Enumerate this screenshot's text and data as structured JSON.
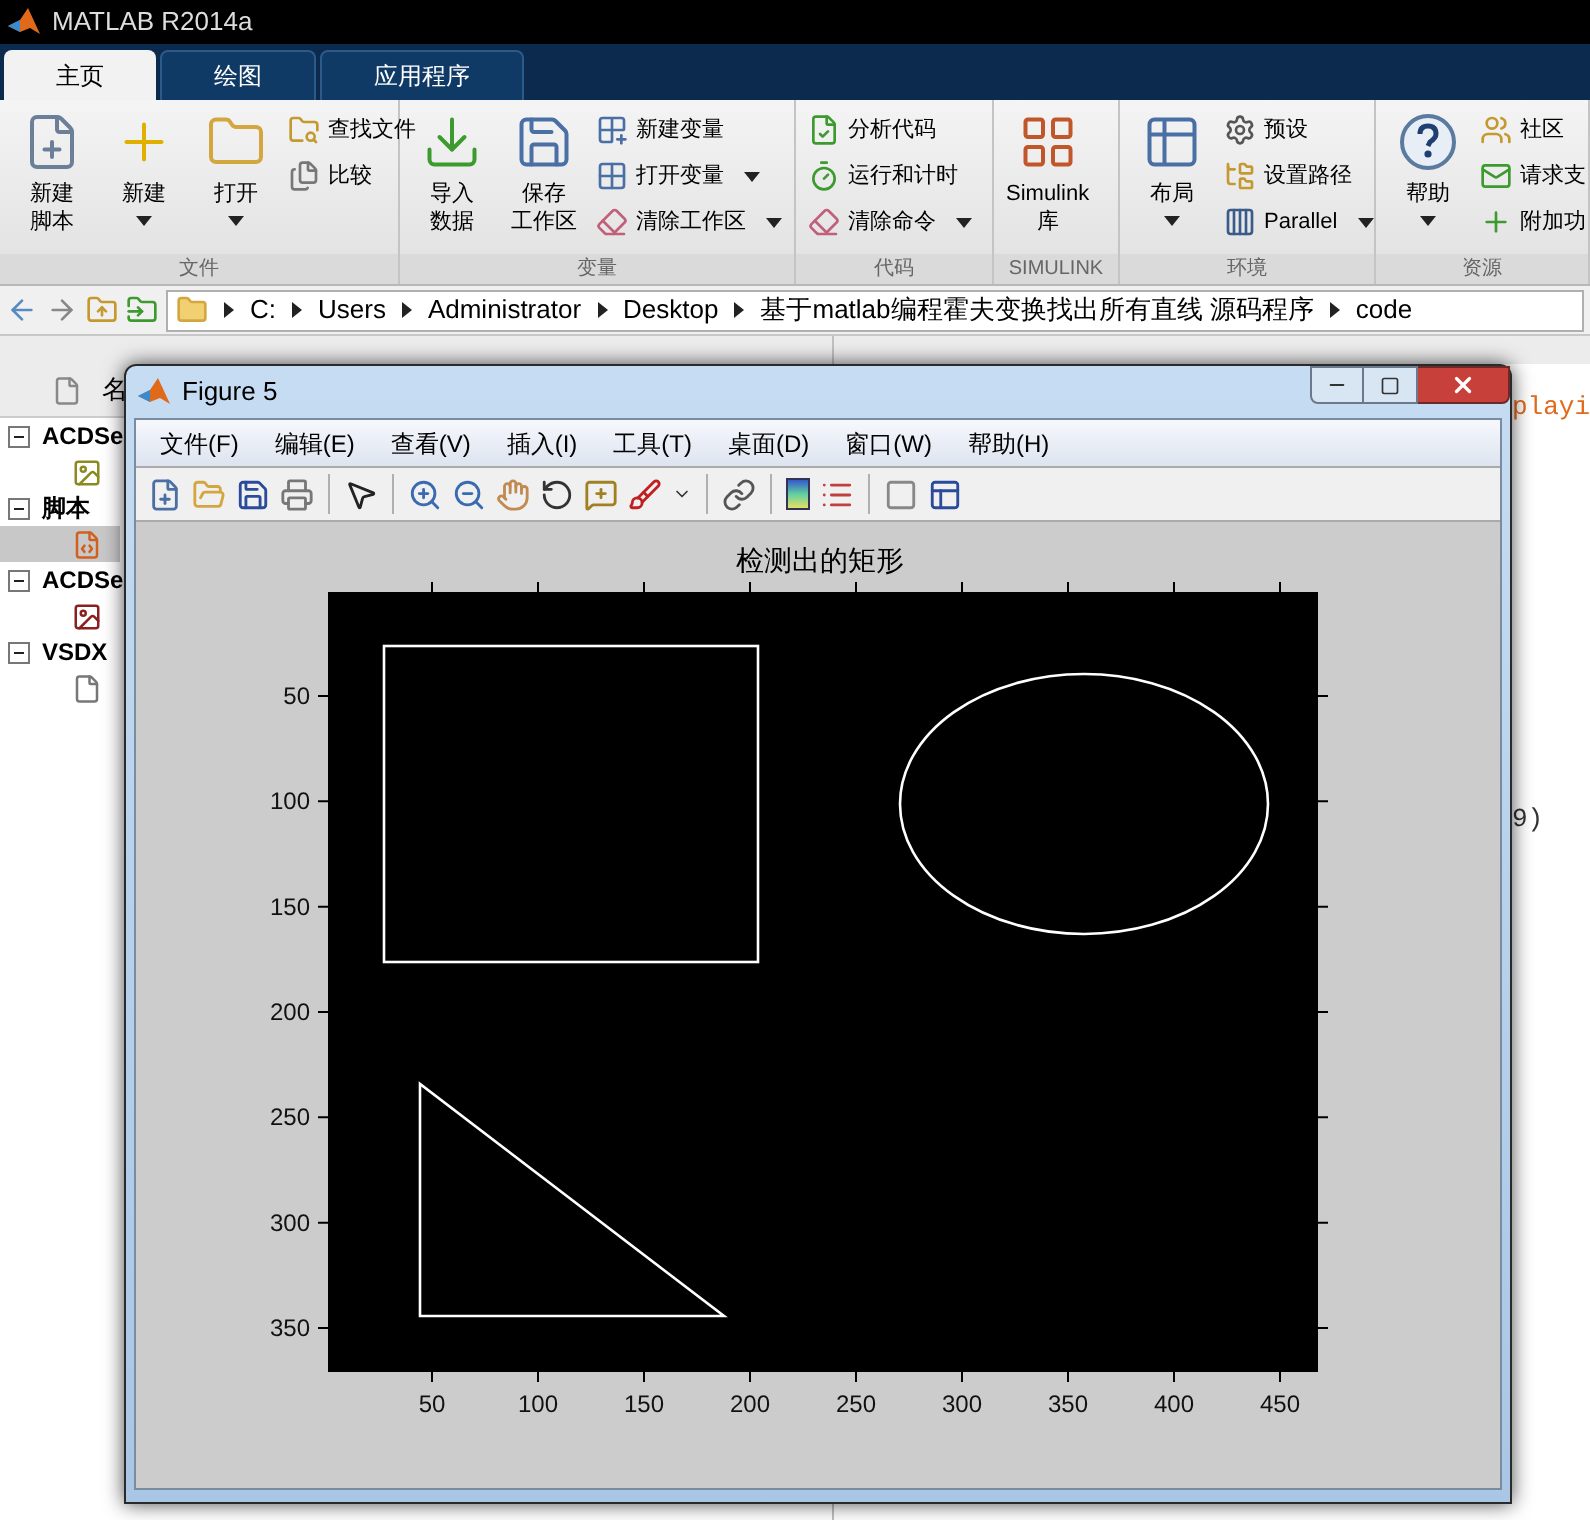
{
  "app_title": "MATLAB R2014a",
  "tabs": [
    {
      "label": "主页",
      "selected": true
    },
    {
      "label": "绘图",
      "selected": false
    },
    {
      "label": "应用程序",
      "selected": false
    }
  ],
  "ribbon_groups": [
    {
      "label": "文件",
      "items": [
        {
          "kind": "large",
          "lines": [
            "新建",
            "脚本"
          ],
          "dropdown": false
        },
        {
          "kind": "large",
          "lines": [
            "新建"
          ],
          "dropdown": true
        },
        {
          "kind": "large",
          "lines": [
            "打开"
          ],
          "dropdown": true
        },
        {
          "kind": "small",
          "label": "查找文件",
          "dropdown": false
        },
        {
          "kind": "small",
          "label": "比较",
          "dropdown": false
        }
      ]
    },
    {
      "label": "变量",
      "items": [
        {
          "kind": "large",
          "lines": [
            "导入",
            "数据"
          ],
          "dropdown": false
        },
        {
          "kind": "large",
          "lines": [
            "保存",
            "工作区"
          ],
          "dropdown": false
        },
        {
          "kind": "small",
          "label": "新建变量",
          "dropdown": false
        },
        {
          "kind": "small",
          "label": "打开变量",
          "dropdown": true
        },
        {
          "kind": "small",
          "label": "清除工作区",
          "dropdown": true
        }
      ]
    },
    {
      "label": "代码",
      "items": [
        {
          "kind": "small",
          "label": "分析代码",
          "dropdown": false
        },
        {
          "kind": "small",
          "label": "运行和计时",
          "dropdown": false
        },
        {
          "kind": "small",
          "label": "清除命令",
          "dropdown": true
        }
      ]
    },
    {
      "label": "SIMULINK",
      "items": [
        {
          "kind": "large",
          "lines": [
            "Simulink",
            "库"
          ],
          "dropdown": false
        }
      ]
    },
    {
      "label": "环境",
      "items": [
        {
          "kind": "large",
          "lines": [
            "布局"
          ],
          "dropdown": true
        },
        {
          "kind": "small",
          "label": "预设",
          "dropdown": false
        },
        {
          "kind": "small",
          "label": "设置路径",
          "dropdown": false
        },
        {
          "kind": "small",
          "label": "Parallel",
          "dropdown": true
        }
      ]
    },
    {
      "label": "资源",
      "items": [
        {
          "kind": "large",
          "lines": [
            "帮助"
          ],
          "dropdown": true
        },
        {
          "kind": "small",
          "label": "社区",
          "dropdown": false
        },
        {
          "kind": "small",
          "label": "请求支",
          "dropdown": false
        },
        {
          "kind": "small",
          "label": "附加功",
          "dropdown": false
        }
      ]
    }
  ],
  "path": [
    "C:",
    "Users",
    "Administrator",
    "Desktop",
    "基于matlab编程霍夫变换找出所有直线 源码程序",
    "code"
  ],
  "current_folder": {
    "column_header": "名",
    "tree": [
      {
        "label": "ACDSe",
        "expanded": true,
        "children": [
          {
            "kind": "jpg",
            "selected": false
          }
        ]
      },
      {
        "label": "脚本",
        "expanded": true,
        "children": [
          {
            "kind": "script",
            "selected": true
          }
        ]
      },
      {
        "label": "ACDSe",
        "expanded": true,
        "children": [
          {
            "kind": "png",
            "selected": false
          }
        ]
      },
      {
        "label": "VSDX",
        "expanded": true,
        "children": [
          {
            "kind": "doc",
            "selected": false
          }
        ]
      }
    ]
  },
  "command_window": {
    "lines": [
      {
        "text": "playi",
        "kind": "string"
      },
      {
        "text": "9)",
        "kind": "plain"
      }
    ]
  },
  "figure": {
    "title": "Figure 5",
    "menus": [
      "文件(F)",
      "编辑(E)",
      "查看(V)",
      "插入(I)",
      "工具(T)",
      "桌面(D)",
      "窗口(W)",
      "帮助(H)"
    ],
    "axes": {
      "title": "检测出的矩形",
      "xticks": [
        "50",
        "100",
        "150",
        "200",
        "250",
        "300",
        "350",
        "400",
        "450"
      ],
      "yticks": [
        "50",
        "100",
        "150",
        "200",
        "250",
        "300",
        "350"
      ]
    }
  }
}
